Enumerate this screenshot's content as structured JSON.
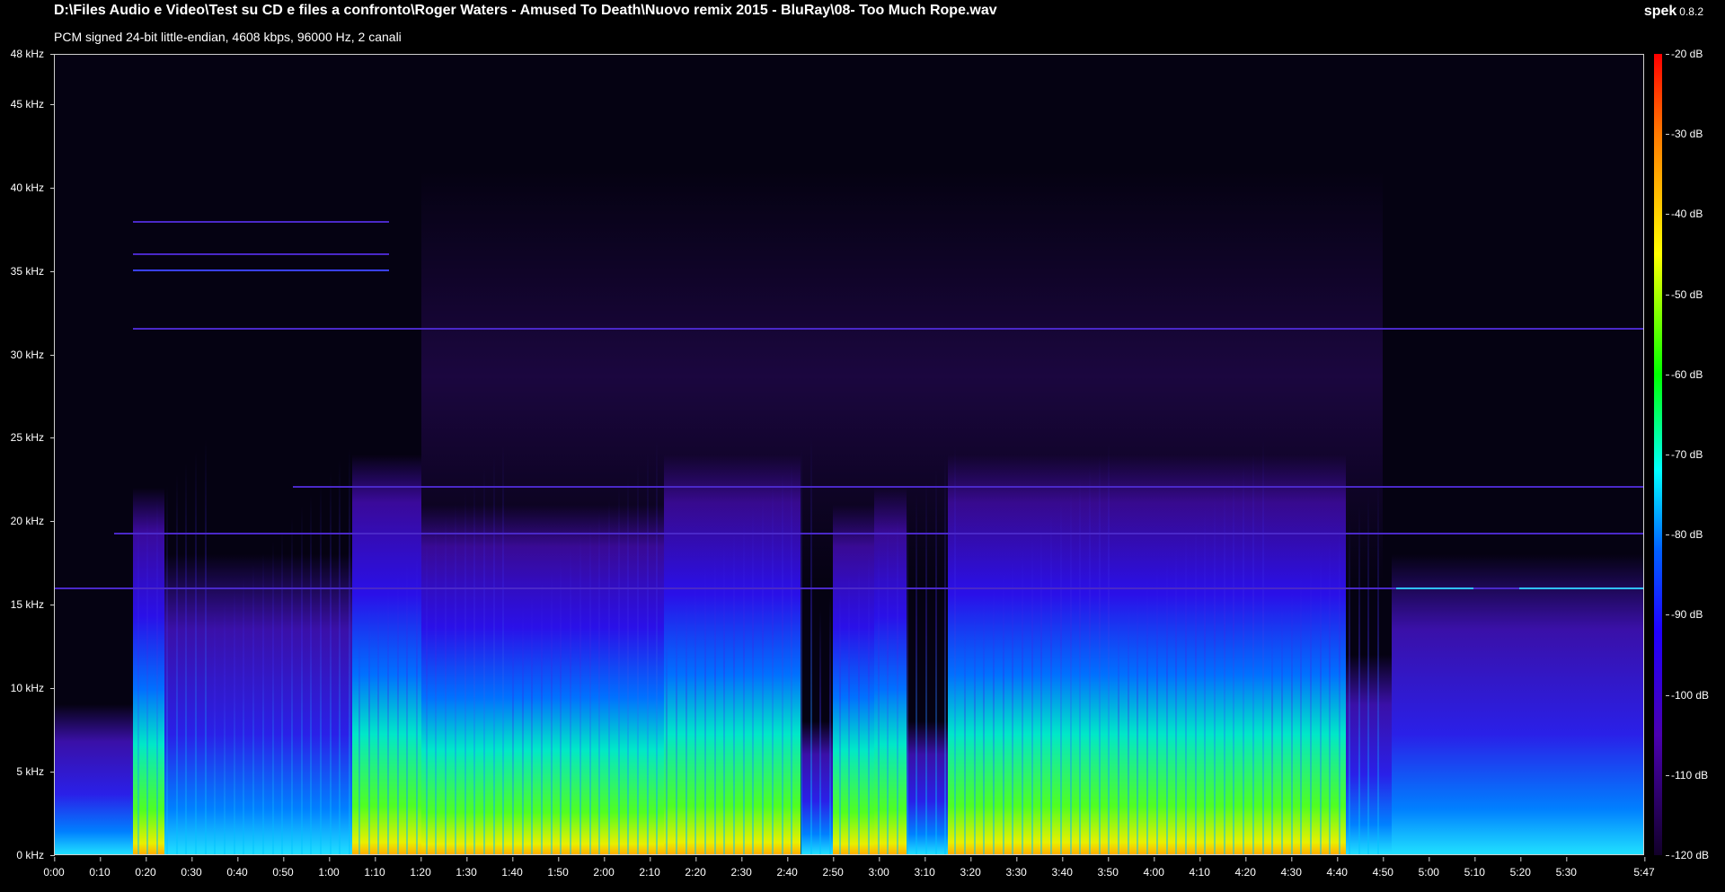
{
  "header": {
    "file_path": "D:\\Files Audio e Video\\Test su CD e files a confronto\\Roger Waters - Amused To Death\\Nuovo remix 2015 - BluRay\\08- Too Much Rope.wav",
    "stream_info": "PCM signed 24-bit little-endian, 4608 kbps, 96000 Hz, 2 canali",
    "app_name": "spek",
    "app_version": "0.8.2"
  },
  "frequency_axis": {
    "max_khz": 48,
    "labels": [
      {
        "khz": 48,
        "label": "48 kHz"
      },
      {
        "khz": 45,
        "label": "45 kHz"
      },
      {
        "khz": 40,
        "label": "40 kHz"
      },
      {
        "khz": 35,
        "label": "35 kHz"
      },
      {
        "khz": 30,
        "label": "30 kHz"
      },
      {
        "khz": 25,
        "label": "25 kHz"
      },
      {
        "khz": 20,
        "label": "20 kHz"
      },
      {
        "khz": 15,
        "label": "15 kHz"
      },
      {
        "khz": 10,
        "label": "10 kHz"
      },
      {
        "khz": 5,
        "label": "5 kHz"
      },
      {
        "khz": 0,
        "label": "0 kHz"
      }
    ]
  },
  "time_axis": {
    "duration_s": 347,
    "labels": [
      {
        "t": 0,
        "label": "0:00"
      },
      {
        "t": 10,
        "label": "0:10"
      },
      {
        "t": 20,
        "label": "0:20"
      },
      {
        "t": 30,
        "label": "0:30"
      },
      {
        "t": 40,
        "label": "0:40"
      },
      {
        "t": 50,
        "label": "0:50"
      },
      {
        "t": 60,
        "label": "1:00"
      },
      {
        "t": 70,
        "label": "1:10"
      },
      {
        "t": 80,
        "label": "1:20"
      },
      {
        "t": 90,
        "label": "1:30"
      },
      {
        "t": 100,
        "label": "1:40"
      },
      {
        "t": 110,
        "label": "1:50"
      },
      {
        "t": 120,
        "label": "2:00"
      },
      {
        "t": 130,
        "label": "2:10"
      },
      {
        "t": 140,
        "label": "2:20"
      },
      {
        "t": 150,
        "label": "2:30"
      },
      {
        "t": 160,
        "label": "2:40"
      },
      {
        "t": 170,
        "label": "2:50"
      },
      {
        "t": 180,
        "label": "3:00"
      },
      {
        "t": 190,
        "label": "3:10"
      },
      {
        "t": 200,
        "label": "3:20"
      },
      {
        "t": 210,
        "label": "3:30"
      },
      {
        "t": 220,
        "label": "3:40"
      },
      {
        "t": 230,
        "label": "3:50"
      },
      {
        "t": 240,
        "label": "4:00"
      },
      {
        "t": 250,
        "label": "4:10"
      },
      {
        "t": 260,
        "label": "4:20"
      },
      {
        "t": 270,
        "label": "4:30"
      },
      {
        "t": 280,
        "label": "4:40"
      },
      {
        "t": 290,
        "label": "4:50"
      },
      {
        "t": 300,
        "label": "5:00"
      },
      {
        "t": 310,
        "label": "5:10"
      },
      {
        "t": 320,
        "label": "5:20"
      },
      {
        "t": 330,
        "label": "5:30"
      },
      {
        "t": 347,
        "label": "5:47"
      }
    ]
  },
  "db_scale": {
    "labels": [
      {
        "db": -20,
        "label": "-20 dB"
      },
      {
        "db": -30,
        "label": "-30 dB"
      },
      {
        "db": -40,
        "label": "-40 dB"
      },
      {
        "db": -50,
        "label": "-50 dB"
      },
      {
        "db": -60,
        "label": "-60 dB"
      },
      {
        "db": -70,
        "label": "-70 dB"
      },
      {
        "db": -80,
        "label": "-80 dB"
      },
      {
        "db": -90,
        "label": "-90 dB"
      },
      {
        "db": -100,
        "label": "-100 dB"
      },
      {
        "db": -110,
        "label": "-110 dB"
      },
      {
        "db": -120,
        "label": "-120 dB"
      }
    ]
  },
  "colors": {
    "background": "#000000",
    "text": "#ffffff",
    "axis": "#cfcfcf",
    "palette": [
      "#ff0000",
      "#ff7a00",
      "#ffff00",
      "#00ff00",
      "#00ffff",
      "#0060ff",
      "#2000ff",
      "#4a00b0",
      "#12002a"
    ]
  }
}
